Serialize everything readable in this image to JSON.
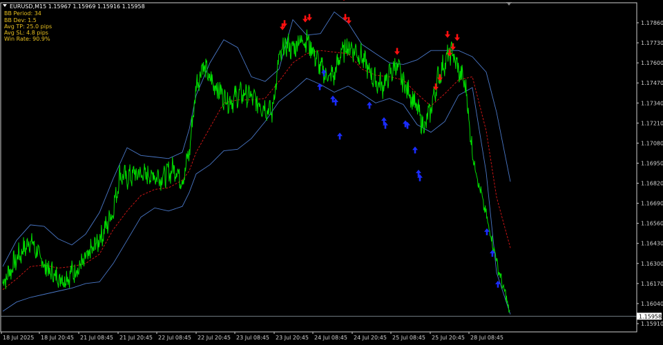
{
  "header": {
    "symbol_line": "EURUSD,M15  1.15967 1.15969 1.15916 1.15958",
    "stats": [
      "BB Period: 34",
      "BB Dev: 1.5",
      "Avg TP: 25.0 pips",
      "Avg SL: 4.8 pips",
      "Win Rate: 90.9%"
    ]
  },
  "current_price_label": "1.15958",
  "colors": {
    "background": "#000000",
    "frame": "#cfcfcf",
    "price": "#00dd00",
    "band": "#4a78c8",
    "middle": "#c81414",
    "sell_arrow": "#ff1010",
    "buy_arrow": "#1a2cff",
    "text_yellow": "#e8c020",
    "text_white": "#ffffff",
    "axis_text": "#d0d0d0"
  },
  "chart_data": {
    "type": "line",
    "title": "",
    "y_axis_ticks": [
      "1.17860",
      "1.17730",
      "1.17600",
      "1.17470",
      "1.17340",
      "1.17210",
      "1.17080",
      "1.16950",
      "1.16820",
      "1.16690",
      "1.16560",
      "1.16430",
      "1.16300",
      "1.16170",
      "1.16040",
      "1.15910"
    ],
    "x_axis_ticks": [
      "18 Jul 2025",
      "18 Jul 20:45",
      "21 Jul 08:45",
      "21 Jul 20:45",
      "22 Jul 08:45",
      "22 Jul 20:45",
      "23 Jul 08:45",
      "23 Jul 20:45",
      "24 Jul 08:45",
      "24 Jul 20:45",
      "25 Jul 08:45",
      "25 Jul 20:45",
      "28 Jul 08:45"
    ],
    "ylim": [
      1.1591,
      1.1792
    ],
    "series": [
      {
        "role": "price",
        "x": [
          0,
          10,
          20,
          30,
          40,
          50,
          60,
          70,
          80,
          90,
          100,
          110,
          120,
          130,
          140,
          150,
          160,
          170,
          180,
          190,
          200,
          210,
          220,
          230,
          240,
          250,
          260,
          270,
          280,
          290,
          300,
          310,
          320,
          330,
          340,
          350,
          360,
          370,
          380,
          390,
          400,
          410,
          420,
          430,
          440,
          450,
          460,
          470,
          480,
          490,
          500,
          510,
          520,
          530,
          540,
          550,
          560,
          570,
          580,
          590,
          600,
          610,
          620,
          630,
          640,
          650,
          660,
          670,
          680,
          690,
          700,
          710,
          720,
          730,
          735
        ],
        "values": [
          1.1617,
          1.1625,
          1.1633,
          1.1639,
          1.1645,
          1.1637,
          1.1629,
          1.1624,
          1.1621,
          1.162,
          1.1624,
          1.1627,
          1.1632,
          1.1639,
          1.1646,
          1.1654,
          1.1665,
          1.1688,
          1.1685,
          1.1688,
          1.1688,
          1.1687,
          1.1687,
          1.1686,
          1.1689,
          1.1692,
          1.1683,
          1.1702,
          1.1745,
          1.1759,
          1.1749,
          1.1744,
          1.1738,
          1.1735,
          1.1739,
          1.174,
          1.1738,
          1.1734,
          1.1731,
          1.1728,
          1.1762,
          1.1772,
          1.1769,
          1.1775,
          1.1775,
          1.1767,
          1.1757,
          1.1751,
          1.1752,
          1.1767,
          1.1771,
          1.1768,
          1.1764,
          1.1755,
          1.1748,
          1.1745,
          1.1752,
          1.1759,
          1.1747,
          1.174,
          1.173,
          1.1718,
          1.173,
          1.175,
          1.176,
          1.1768,
          1.1755,
          1.1746,
          1.1701,
          1.168,
          1.1661,
          1.1642,
          1.1622,
          1.1606,
          1.1596
        ]
      },
      {
        "role": "upper-band",
        "x": [
          0,
          20,
          40,
          60,
          80,
          100,
          120,
          140,
          160,
          180,
          200,
          220,
          240,
          260,
          270,
          280,
          300,
          320,
          340,
          360,
          380,
          400,
          420,
          440,
          460,
          480,
          500,
          520,
          540,
          560,
          580,
          600,
          620,
          640,
          660,
          680,
          700,
          715,
          735
        ],
        "values": [
          1.1628,
          1.1645,
          1.1655,
          1.1654,
          1.1646,
          1.1642,
          1.1649,
          1.1663,
          1.1685,
          1.1705,
          1.17,
          1.1699,
          1.1698,
          1.1702,
          1.1717,
          1.1739,
          1.176,
          1.1775,
          1.177,
          1.1751,
          1.1748,
          1.1756,
          1.1788,
          1.1778,
          1.1779,
          1.1793,
          1.1786,
          1.1772,
          1.1766,
          1.176,
          1.1759,
          1.1762,
          1.1768,
          1.1768,
          1.1768,
          1.1764,
          1.1754,
          1.1728,
          1.1683
        ]
      },
      {
        "role": "middle-band",
        "x": [
          0,
          20,
          40,
          60,
          80,
          100,
          120,
          140,
          160,
          180,
          200,
          220,
          240,
          260,
          270,
          280,
          300,
          320,
          340,
          360,
          380,
          400,
          420,
          440,
          460,
          480,
          500,
          520,
          540,
          560,
          580,
          600,
          620,
          640,
          660,
          680,
          700,
          715,
          735
        ],
        "values": [
          1.1613,
          1.162,
          1.1628,
          1.1629,
          1.1627,
          1.1628,
          1.163,
          1.1636,
          1.1652,
          1.1664,
          1.1674,
          1.1678,
          1.1679,
          1.1684,
          1.169,
          1.1702,
          1.1718,
          1.1734,
          1.1736,
          1.1736,
          1.1737,
          1.1748,
          1.176,
          1.1766,
          1.1768,
          1.1767,
          1.1766,
          1.1756,
          1.1752,
          1.1751,
          1.1749,
          1.174,
          1.1732,
          1.174,
          1.1749,
          1.1751,
          1.1716,
          1.1673,
          1.164
        ]
      },
      {
        "role": "lower-band",
        "x": [
          0,
          20,
          40,
          60,
          80,
          100,
          120,
          140,
          160,
          180,
          200,
          220,
          240,
          260,
          270,
          280,
          300,
          320,
          340,
          360,
          380,
          400,
          420,
          440,
          460,
          480,
          500,
          520,
          540,
          560,
          580,
          600,
          620,
          640,
          660,
          680,
          700,
          715,
          735
        ],
        "values": [
          1.1599,
          1.1605,
          1.1608,
          1.161,
          1.1612,
          1.1614,
          1.1617,
          1.1618,
          1.163,
          1.1645,
          1.166,
          1.1666,
          1.1664,
          1.1667,
          1.1676,
          1.1688,
          1.1694,
          1.1703,
          1.1704,
          1.1711,
          1.1722,
          1.1735,
          1.1742,
          1.175,
          1.1746,
          1.1741,
          1.1745,
          1.174,
          1.1734,
          1.1737,
          1.1733,
          1.172,
          1.1715,
          1.1722,
          1.1739,
          1.1744,
          1.1689,
          1.1624,
          1.1597
        ]
      }
    ],
    "signals": [
      {
        "type": "sell",
        "x": 405,
        "y": 1.1783
      },
      {
        "type": "sell",
        "x": 408,
        "y": 1.1785
      },
      {
        "type": "sell",
        "x": 438,
        "y": 1.1788
      },
      {
        "type": "sell",
        "x": 444,
        "y": 1.1789
      },
      {
        "type": "sell",
        "x": 494,
        "y": 1.1802
      },
      {
        "type": "sell",
        "x": 496,
        "y": 1.1789
      },
      {
        "type": "sell",
        "x": 501,
        "y": 1.1787
      },
      {
        "type": "sell",
        "x": 571,
        "y": 1.1767
      },
      {
        "type": "sell",
        "x": 627,
        "y": 1.1744
      },
      {
        "type": "sell",
        "x": 633,
        "y": 1.175
      },
      {
        "type": "sell",
        "x": 644,
        "y": 1.1778
      },
      {
        "type": "sell",
        "x": 647,
        "y": 1.1766
      },
      {
        "type": "sell",
        "x": 652,
        "y": 1.177
      },
      {
        "type": "sell",
        "x": 658,
        "y": 1.1776
      },
      {
        "type": "buy",
        "x": 459,
        "y": 1.1745
      },
      {
        "type": "buy",
        "x": 465,
        "y": 1.1754
      },
      {
        "type": "buy",
        "x": 478,
        "y": 1.1737
      },
      {
        "type": "buy",
        "x": 482,
        "y": 1.1735
      },
      {
        "type": "buy",
        "x": 488,
        "y": 1.1713
      },
      {
        "type": "buy",
        "x": 531,
        "y": 1.1733
      },
      {
        "type": "buy",
        "x": 552,
        "y": 1.1723
      },
      {
        "type": "buy",
        "x": 554,
        "y": 1.172
      },
      {
        "type": "buy",
        "x": 583,
        "y": 1.1721
      },
      {
        "type": "buy",
        "x": 586,
        "y": 1.172
      },
      {
        "type": "buy",
        "x": 597,
        "y": 1.1704
      },
      {
        "type": "buy",
        "x": 602,
        "y": 1.1689
      },
      {
        "type": "buy",
        "x": 604,
        "y": 1.1686
      },
      {
        "type": "buy",
        "x": 701,
        "y": 1.1651
      },
      {
        "type": "buy",
        "x": 709,
        "y": 1.1637
      },
      {
        "type": "buy",
        "x": 717,
        "y": 1.1617
      }
    ],
    "current_price": 1.15958,
    "grid": false,
    "legend": "none"
  }
}
